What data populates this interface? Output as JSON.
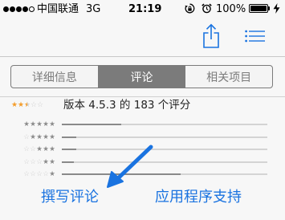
{
  "statusbar": {
    "signal_bars": [
      1,
      1,
      1,
      1,
      0
    ],
    "carrier": "中国联通",
    "network": "3G",
    "time": "21:19",
    "battery_percent": "100%",
    "battery_level": 1.0,
    "icons": [
      "signal-dots-icon",
      "rotation-lock-icon",
      "alarm-clock-icon",
      "battery-icon",
      "charging-bolt-icon"
    ]
  },
  "toolbar": {
    "icons": [
      "share-icon",
      "list-menu-icon"
    ],
    "accent_color": "#1a73e0"
  },
  "segmented": {
    "tabs": [
      {
        "label": "详细信息",
        "active": false
      },
      {
        "label": "评论",
        "active": true
      },
      {
        "label": "相关项目",
        "active": false
      }
    ],
    "active_color": "#7b7b7b"
  },
  "summary": {
    "rating_stars": 2.5,
    "text": "版本 4.5.3 的 183 个评分",
    "star_color": "#f49d2b"
  },
  "histogram": [
    {
      "stars": 5,
      "fraction": 0.29
    },
    {
      "stars": 4,
      "fraction": 0.07
    },
    {
      "stars": 3,
      "fraction": 0.07
    },
    {
      "stars": 2,
      "fraction": 0.06
    },
    {
      "stars": 1,
      "fraction": 0.58
    }
  ],
  "annotation": {
    "type": "arrow",
    "color": "#1a73e0",
    "points_to": "write-review-link"
  },
  "links": {
    "write_review": "撰写评论",
    "app_support": "应用程序支持"
  }
}
